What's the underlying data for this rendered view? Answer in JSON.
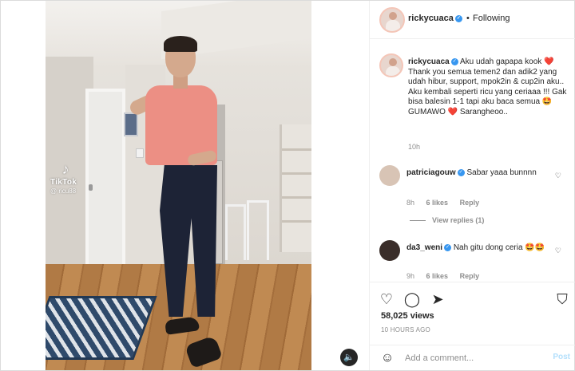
{
  "video": {
    "watermark_brand": "TikTok",
    "watermark_user": "@ ricu88",
    "audio_icon": "speaker-icon"
  },
  "header": {
    "username": "rickycuaca",
    "separator": "•",
    "follow_status": "Following"
  },
  "caption": {
    "username": "rickycuaca",
    "text": "Aku udah gapapa kook ❤️ Thank you semua temen2 dan adik2 yang udah hibur, support, mpok2in & cup2in aku.. Aku kembali seperti ricu yang ceriaaa !!! Gak bisa balesin 1-1 tapi aku baca semua 🤩 GUMAWO ❤️ Sarangheoo..",
    "time": "10h"
  },
  "comments": [
    {
      "username": "patriciagouw",
      "text": "Sabar yaaa bunnnn",
      "time": "8h",
      "likes": "6 likes",
      "reply": "Reply",
      "view_replies": "View replies (1)"
    },
    {
      "username": "da3_weni",
      "text": "Nah gitu dong ceria 🤩🤩",
      "time": "9h",
      "likes": "6 likes",
      "reply": "Reply"
    }
  ],
  "actions": {
    "like_icon": "heart-icon",
    "comment_icon": "comment-icon",
    "share_icon": "share-icon",
    "save_icon": "bookmark-icon",
    "views": "58,025 views",
    "posted": "10 HOURS AGO"
  },
  "composer": {
    "placeholder": "Add a comment...",
    "post_label": "Post",
    "emoji_icon": "smiley-icon"
  },
  "colors": {
    "verified": "#3897f0",
    "heart": "#ed4956",
    "muted": "#8e8e8e",
    "post_disabled": "#b2dffc"
  }
}
